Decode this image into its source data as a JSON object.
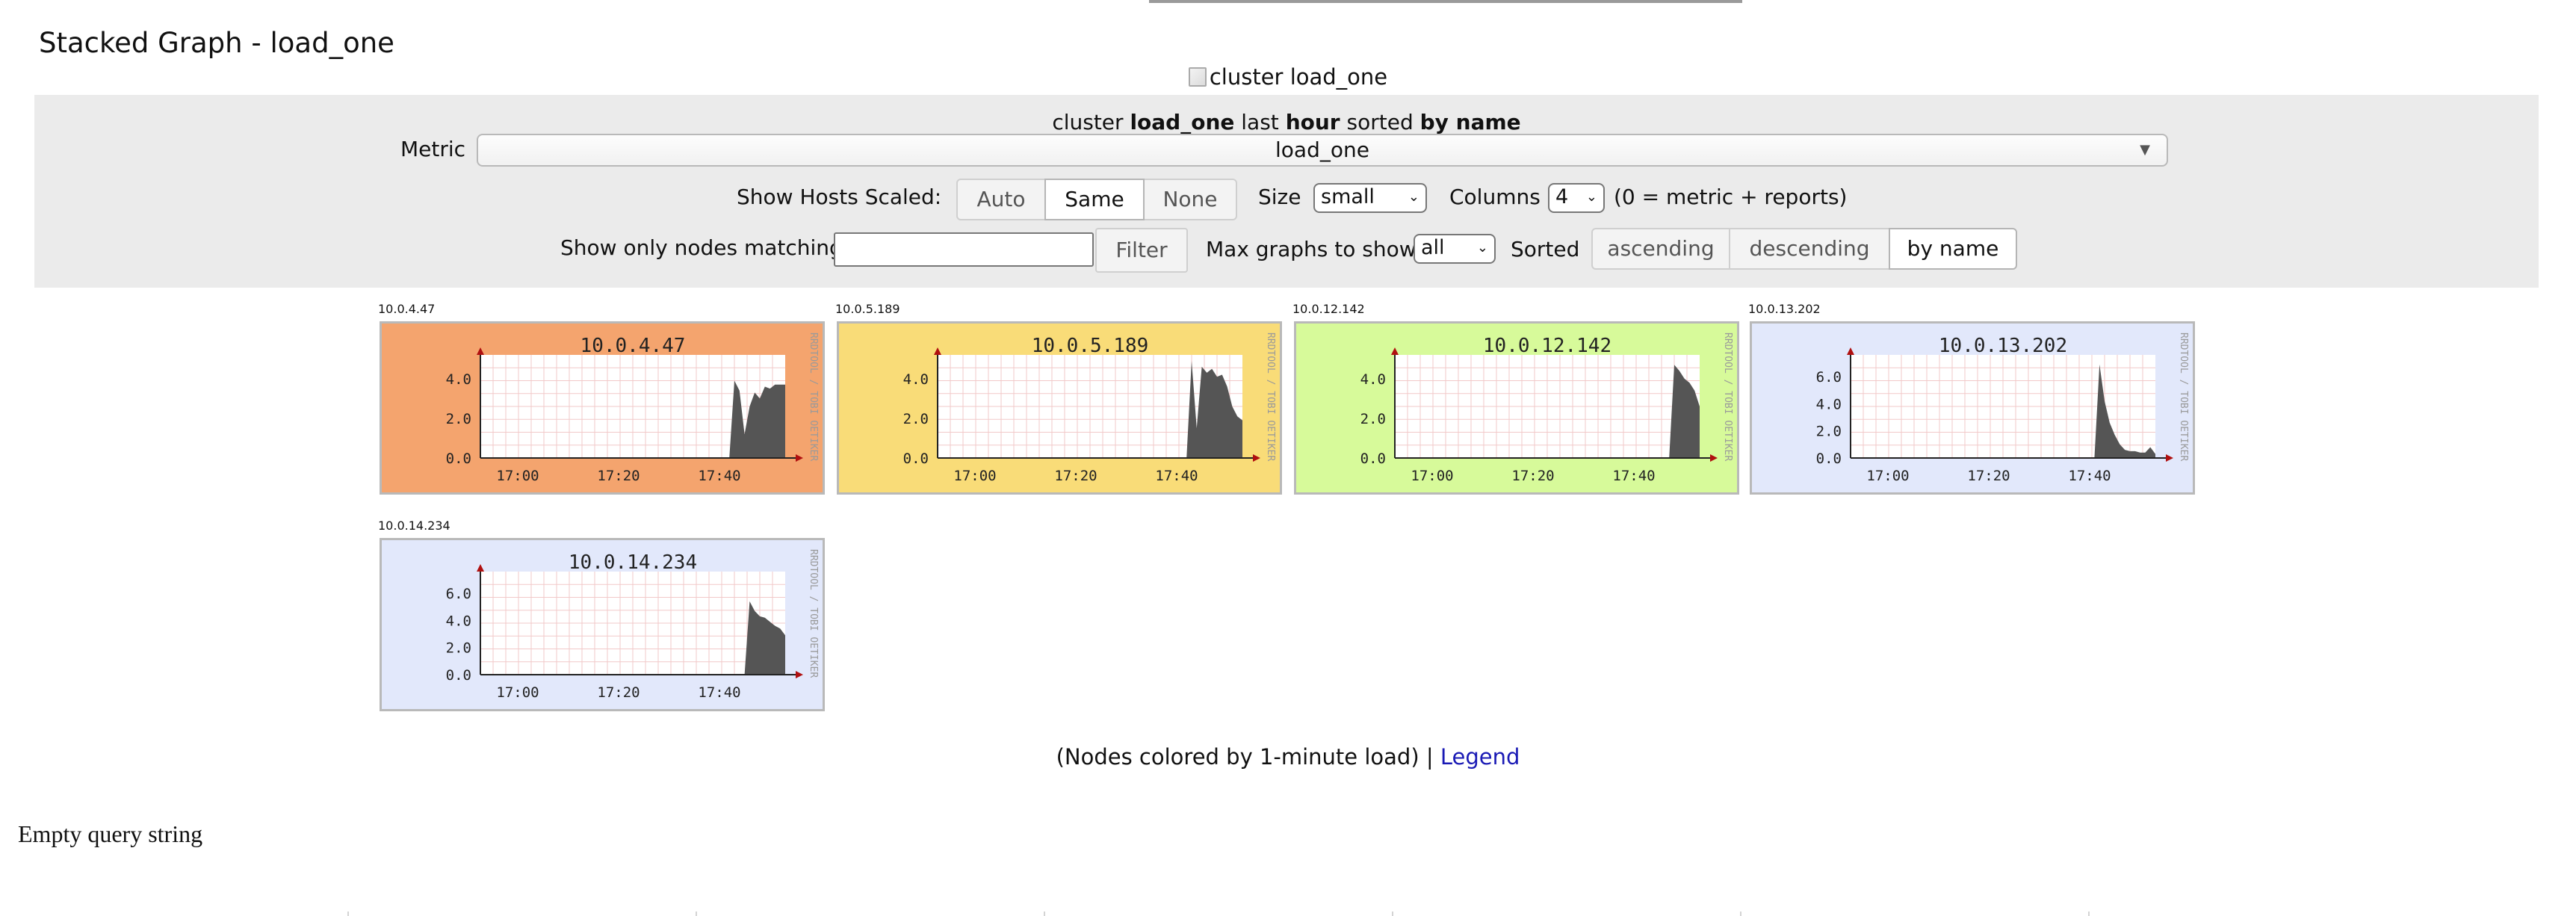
{
  "page": {
    "title": "Stacked Graph - load_one",
    "cluster_image_alt": "cluster load_one"
  },
  "summary": {
    "pre": "cluster ",
    "metric": "load_one",
    "mid1": " last ",
    "range": "hour",
    "mid2": " sorted ",
    "sort": "by name"
  },
  "controls": {
    "metric_label": "Metric",
    "metric_value": "load_one",
    "scaled_label": "Show Hosts Scaled:",
    "scaled_options": [
      "Auto",
      "Same",
      "None"
    ],
    "scaled_selected": "Same",
    "size_label": "Size",
    "size_value": "small",
    "columns_label": "Columns",
    "columns_value": "4",
    "columns_note": "(0 = metric + reports)",
    "match_label": "Show only nodes matching",
    "match_value": "",
    "filter_label": "Filter",
    "max_label": "Max graphs to show",
    "max_value": "all",
    "sorted_label": "Sorted",
    "sort_options": [
      "ascending",
      "descending",
      "by name"
    ],
    "sort_selected": "by name"
  },
  "graphs": [
    {
      "label": "10.0.4.47",
      "title": "10.0.4.47",
      "bg": "#f4a46e",
      "yticks": [
        "4.0",
        "2.0",
        "0.0"
      ],
      "ymax": 5.2,
      "xticks": [
        "17:00",
        "17:20",
        "17:40"
      ],
      "watermark": "RRDTOOL / TOBI OETIKER",
      "series": [
        0,
        0,
        0,
        0,
        0,
        0,
        0,
        0,
        0,
        0,
        0,
        0,
        0,
        0,
        0,
        0,
        0,
        0,
        0,
        0,
        0,
        0,
        0,
        0,
        0,
        0,
        0,
        0,
        0,
        0,
        0,
        0,
        0,
        0,
        0,
        0,
        0,
        0,
        0,
        0,
        0,
        0,
        0,
        0,
        0,
        0,
        0,
        0,
        0,
        0,
        3.9,
        3.4,
        1.2,
        2.6,
        3.3,
        3.0,
        3.6,
        3.5,
        3.7,
        3.7,
        3.7
      ]
    },
    {
      "label": "10.0.5.189",
      "title": "10.0.5.189",
      "bg": "#f9dc78",
      "yticks": [
        "4.0",
        "2.0",
        "0.0"
      ],
      "ymax": 5.2,
      "xticks": [
        "17:00",
        "17:20",
        "17:40"
      ],
      "watermark": "RRDTOOL / TOBI OETIKER",
      "series": [
        0,
        0,
        0,
        0,
        0,
        0,
        0,
        0,
        0,
        0,
        0,
        0,
        0,
        0,
        0,
        0,
        0,
        0,
        0,
        0,
        0,
        0,
        0,
        0,
        0,
        0,
        0,
        0,
        0,
        0,
        0,
        0,
        0,
        0,
        0,
        0,
        0,
        0,
        0,
        0,
        0,
        0,
        0,
        0,
        0,
        0,
        0,
        0,
        0,
        0,
        4.9,
        1.5,
        4.6,
        4.3,
        4.5,
        4.1,
        4.2,
        3.6,
        2.6,
        2.1,
        1.9
      ]
    },
    {
      "label": "10.0.12.142",
      "title": "10.0.12.142",
      "bg": "#d7fa9a",
      "yticks": [
        "4.0",
        "2.0",
        "0.0"
      ],
      "ymax": 5.2,
      "xticks": [
        "17:00",
        "17:20",
        "17:40"
      ],
      "watermark": "RRDTOOL / TOBI OETIKER",
      "series": [
        0,
        0,
        0,
        0,
        0,
        0,
        0,
        0,
        0,
        0,
        0,
        0,
        0,
        0,
        0,
        0,
        0,
        0,
        0,
        0,
        0,
        0,
        0,
        0,
        0,
        0,
        0,
        0,
        0,
        0,
        0,
        0,
        0,
        0,
        0,
        0,
        0,
        0,
        0,
        0,
        0,
        0,
        0,
        0,
        0,
        0,
        0,
        0,
        0,
        0,
        0,
        0,
        0,
        0,
        0,
        4.7,
        4.4,
        4.0,
        3.8,
        3.4,
        2.6
      ]
    },
    {
      "label": "10.0.13.202",
      "title": "10.0.13.202",
      "bg": "#e2e8fb",
      "yticks": [
        "6.0",
        "4.0",
        "2.0",
        "0.0"
      ],
      "ymax": 7.6,
      "xticks": [
        "17:00",
        "17:20",
        "17:40"
      ],
      "watermark": "RRDTOOL / TOBI OETIKER",
      "series": [
        0,
        0,
        0,
        0,
        0,
        0,
        0,
        0,
        0,
        0,
        0,
        0,
        0,
        0,
        0,
        0,
        0,
        0,
        0,
        0,
        0,
        0,
        0,
        0,
        0,
        0,
        0,
        0,
        0,
        0,
        0,
        0,
        0,
        0,
        0,
        0,
        0,
        0,
        0,
        0,
        0,
        0,
        0,
        0,
        0,
        0,
        0,
        0,
        0,
        6.9,
        4.2,
        2.6,
        1.7,
        1.0,
        0.6,
        0.5,
        0.5,
        0.4,
        0.4,
        0.8,
        0.3
      ]
    },
    {
      "label": "10.0.14.234",
      "title": "10.0.14.234",
      "bg": "#e2e8fb",
      "yticks": [
        "6.0",
        "4.0",
        "2.0",
        "0.0"
      ],
      "ymax": 7.6,
      "xticks": [
        "17:00",
        "17:20",
        "17:40"
      ],
      "watermark": "RRDTOOL / TOBI OETIKER",
      "series": [
        0,
        0,
        0,
        0,
        0,
        0,
        0,
        0,
        0,
        0,
        0,
        0,
        0,
        0,
        0,
        0,
        0,
        0,
        0,
        0,
        0,
        0,
        0,
        0,
        0,
        0,
        0,
        0,
        0,
        0,
        0,
        0,
        0,
        0,
        0,
        0,
        0,
        0,
        0,
        0,
        0,
        0,
        0,
        0,
        0,
        0,
        0,
        0,
        0,
        0,
        0,
        0,
        0,
        5.4,
        4.7,
        4.3,
        4.2,
        3.9,
        3.6,
        3.4,
        2.9
      ]
    }
  ],
  "footer": {
    "note": "(Nodes colored by 1-minute load) | ",
    "legend_link": "Legend"
  },
  "error": {
    "message": "Empty query string"
  }
}
